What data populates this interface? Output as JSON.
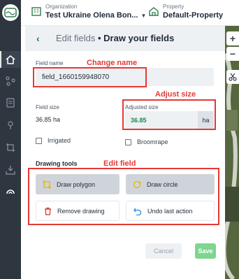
{
  "header": {
    "organization_label": "Organization",
    "organization_value": "Test Ukraine Olena Bon...",
    "property_label": "Property",
    "property_value": "Default-Property"
  },
  "panel": {
    "back_icon": "‹",
    "title_prefix": "Edit fields",
    "title_separator": " • ",
    "title_main": "Draw your fields"
  },
  "form": {
    "field_name_label": "Field name",
    "field_name_value": "field_1660159948070",
    "field_size_label": "Field size",
    "field_size_value": "36.85 ha",
    "adjusted_size_label": "Adjusted size",
    "adjusted_size_value": "36.85",
    "adjusted_size_unit": "ha",
    "irrigated_label": "Irrigated",
    "irrigated_checked": false,
    "broomrape_label": "Broomrape",
    "broomrape_checked": false
  },
  "drawing_tools": {
    "section_title": "Drawing tools",
    "draw_polygon": "Draw polygon",
    "draw_circle": "Draw circle",
    "remove_drawing": "Remove drawing",
    "undo_last_action": "Undo last action"
  },
  "actions": {
    "cancel": "Cancel",
    "save": "Save"
  },
  "annotations": {
    "change_name": "Change name",
    "adjust_size": "Adjust size",
    "edit_field": "Edit field"
  },
  "map_controls": {
    "zoom_in": "+",
    "zoom_out": "−"
  },
  "colors": {
    "accent_green": "#1b8a4a",
    "save_green": "#7fd68e",
    "annotation_red": "#e53935",
    "nav_dark": "#2e3640",
    "tool_yellow": "#e6b800",
    "remove_red": "#d32f2f",
    "undo_blue": "#1e88e5"
  },
  "icons": {
    "nav": [
      "logo-icon",
      "home-icon",
      "fields-icon",
      "notes-icon",
      "location-icon",
      "crop-icon",
      "import-icon",
      "weather-icon"
    ],
    "organization": "organization-icon",
    "property": "property-icon"
  }
}
